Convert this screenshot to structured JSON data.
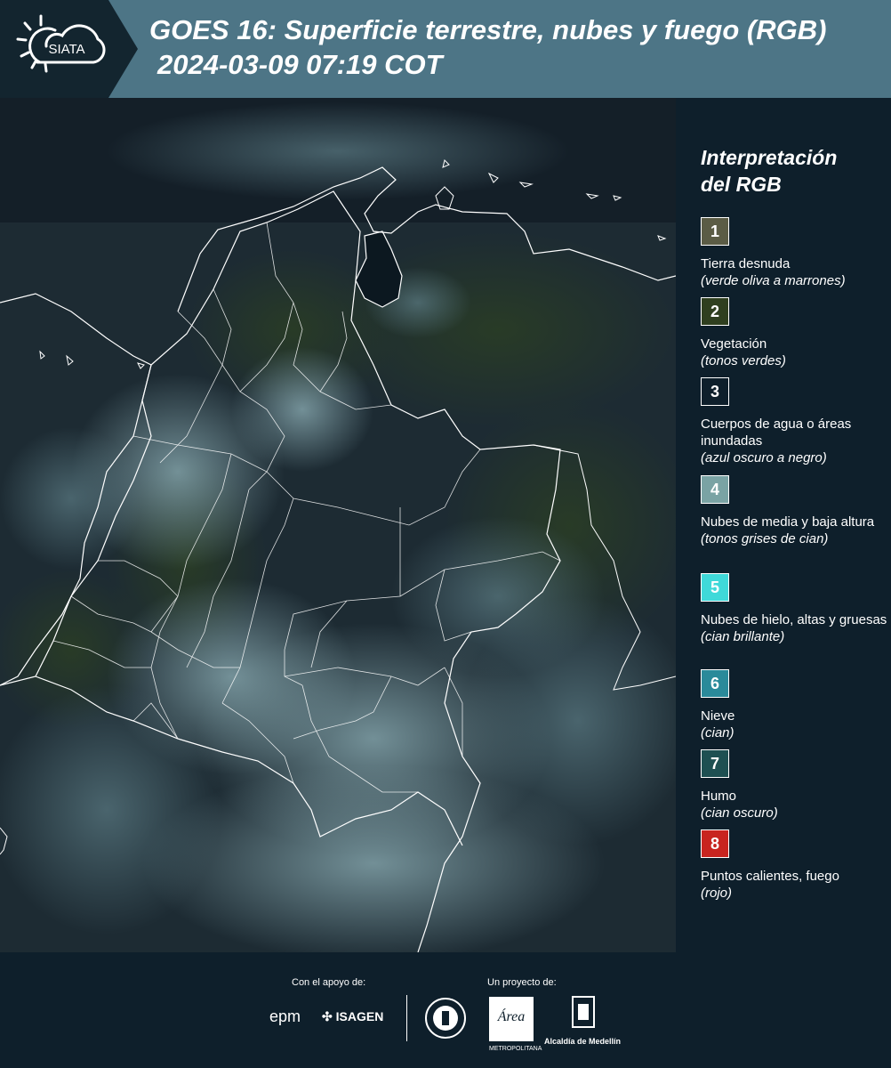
{
  "header": {
    "logo_text": "SIATA",
    "title_line1": "GOES 16: Superficie terrestre, nubes y fuego (RGB)",
    "title_line2": "2024-03-09 07:19 COT"
  },
  "legend": {
    "title_line1": "Interpretación",
    "title_line2": "del RGB",
    "items": [
      {
        "num": "1",
        "color": "#5b5c45",
        "label": "Tierra desnuda",
        "sub": "(verde oliva a marrones)"
      },
      {
        "num": "2",
        "color": "#2f3f1f",
        "label": "Vegetación",
        "sub": "(tonos verdes)"
      },
      {
        "num": "3",
        "color": "#0e1f2b",
        "label": "Cuerpos de agua o áreas inundadas",
        "sub": "(azul oscuro a negro)"
      },
      {
        "num": "4",
        "color": "#7aa3a4",
        "label": "Nubes de media y baja altura",
        "sub": "(tonos grises de cian)"
      },
      {
        "num": "5",
        "color": "#3fd9d9",
        "label": "Nubes de hielo, altas y gruesas",
        "sub": "(cian brillante)"
      },
      {
        "num": "6",
        "color": "#2a8a9a",
        "label": "Nieve",
        "sub": "(cian)"
      },
      {
        "num": "7",
        "color": "#1e5052",
        "label": "Humo",
        "sub": "(cian oscuro)"
      },
      {
        "num": "8",
        "color": "#c8241f",
        "label": "Puntos calientes, fuego",
        "sub": "(rojo)"
      }
    ]
  },
  "footer": {
    "support_label": "Con el apoyo de:",
    "project_label": "Un proyecto de:",
    "sponsor1": "epm",
    "sponsor2": "ISAGEN",
    "partner1": "METROPOLITANA",
    "partner2": "Alcaldía de Medellín"
  }
}
